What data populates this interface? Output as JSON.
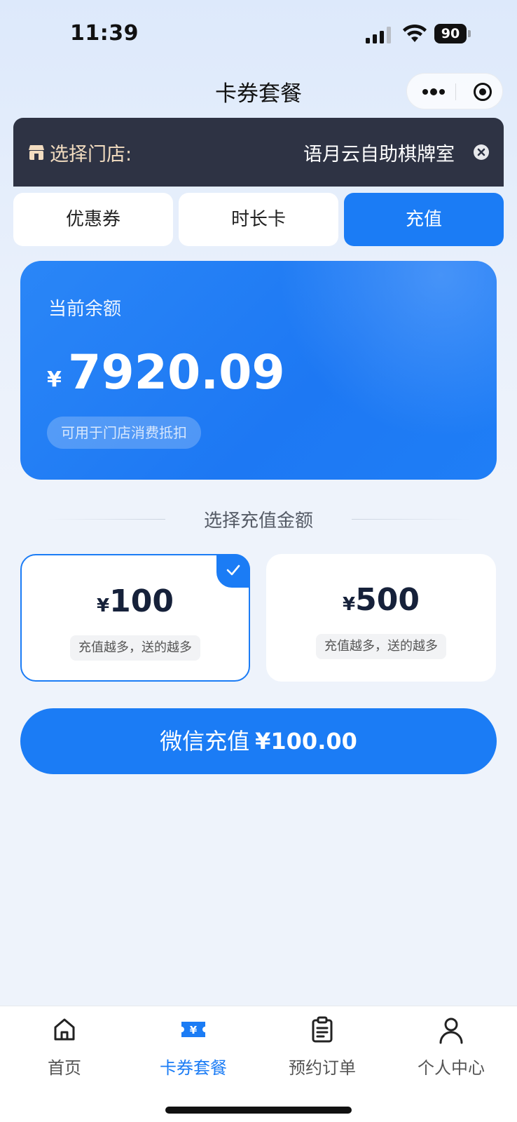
{
  "status_bar": {
    "time": "11:39",
    "battery": "90"
  },
  "nav": {
    "title": "卡券套餐"
  },
  "store": {
    "label": "选择门店:",
    "name": "语月云自助棋牌室"
  },
  "tabs": [
    {
      "label": "优惠券"
    },
    {
      "label": "时长卡"
    },
    {
      "label": "充值",
      "active": true
    }
  ],
  "balance": {
    "label": "当前余额",
    "currency": "¥",
    "amount": "7920.09",
    "note": "可用于门店消费抵扣"
  },
  "section": {
    "title": "选择充值金额"
  },
  "options": [
    {
      "currency": "¥",
      "amount": "100",
      "hint": "充值越多，送的越多",
      "selected": true
    },
    {
      "currency": "¥",
      "amount": "500",
      "hint": "充值越多，送的越多",
      "selected": false
    }
  ],
  "pay_button": {
    "label": "微信充值",
    "amount": "¥100.00"
  },
  "tab_bar": {
    "items": [
      {
        "label": "首页",
        "icon": "home-icon"
      },
      {
        "label": "卡券套餐",
        "icon": "ticket-icon",
        "active": true
      },
      {
        "label": "预约订单",
        "icon": "clipboard-icon"
      },
      {
        "label": "个人中心",
        "icon": "person-icon"
      }
    ]
  },
  "colors": {
    "accent": "#1b7cf5",
    "store_bar": "#2e3344",
    "store_label": "#f2dcc0"
  }
}
